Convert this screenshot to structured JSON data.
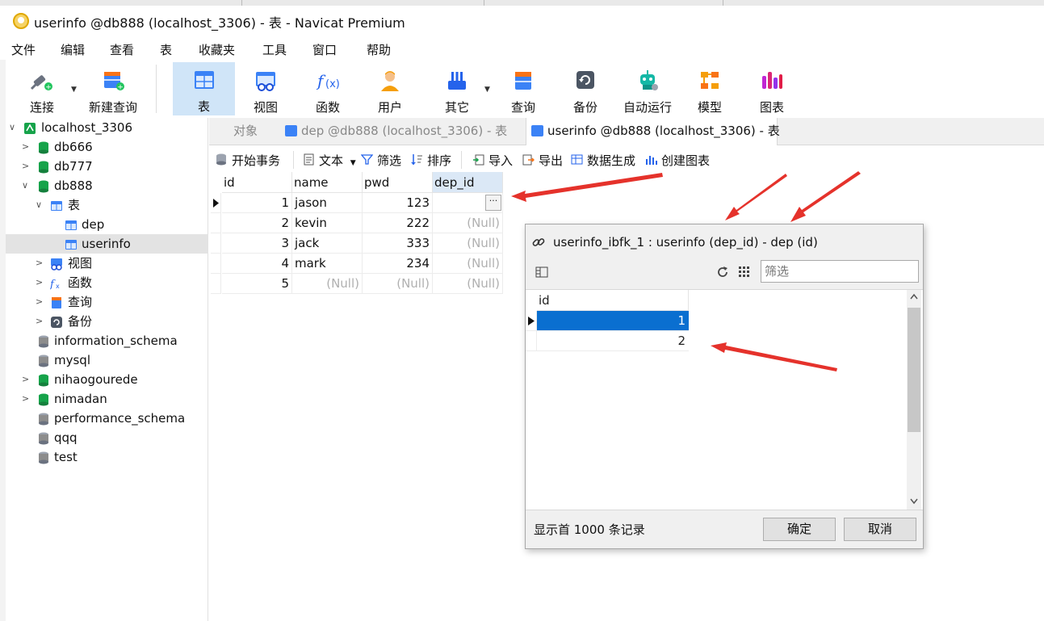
{
  "window": {
    "title": "userinfo @db888 (localhost_3306) - 表 - Navicat Premium"
  },
  "menubar": {
    "items": [
      "文件",
      "编辑",
      "查看",
      "表",
      "收藏夹",
      "工具",
      "窗口",
      "帮助"
    ]
  },
  "toolbar": {
    "buttons": [
      "连接",
      "新建查询",
      "表",
      "视图",
      "函数",
      "用户",
      "其它",
      "查询",
      "备份",
      "自动运行",
      "模型",
      "图表"
    ],
    "active": "表"
  },
  "tree": {
    "items": [
      {
        "label": "localhost_3306"
      },
      {
        "label": "db666"
      },
      {
        "label": "db777"
      },
      {
        "label": "db888"
      },
      {
        "label": "表"
      },
      {
        "label": "dep"
      },
      {
        "label": "userinfo"
      },
      {
        "label": "视图"
      },
      {
        "label": "函数"
      },
      {
        "label": "查询"
      },
      {
        "label": "备份"
      },
      {
        "label": "information_schema"
      },
      {
        "label": "mysql"
      },
      {
        "label": "nihaogourede"
      },
      {
        "label": "nimadan"
      },
      {
        "label": "performance_schema"
      },
      {
        "label": "qqq"
      },
      {
        "label": "test"
      }
    ],
    "selected": "userinfo"
  },
  "doctabs": {
    "tabs": [
      "对象",
      "dep @db888 (localhost_3306) - 表",
      "userinfo @db888 (localhost_3306) - 表"
    ],
    "active": "userinfo @db888 (localhost_3306) - 表"
  },
  "datatoolbar": {
    "buttons": [
      "开始事务",
      "文本",
      "筛选",
      "排序",
      "导入",
      "导出",
      "数据生成",
      "创建图表"
    ]
  },
  "grid": {
    "columns": [
      "id",
      "name",
      "pwd",
      "dep_id"
    ],
    "rows": [
      [
        "1",
        "jason",
        "123",
        ""
      ],
      [
        "2",
        "kevin",
        "222",
        "(Null)"
      ],
      [
        "3",
        "jack",
        "333",
        "(Null)"
      ],
      [
        "4",
        "mark",
        "234",
        "(Null)"
      ],
      [
        "5",
        "(Null)",
        "(Null)",
        "(Null)"
      ]
    ],
    "ellipsis": "···"
  },
  "popup": {
    "title": "userinfo_ibfk_1 : userinfo (dep_id) - dep (id)",
    "filter_placeholder": "筛选",
    "column": "id",
    "rows": [
      "1",
      "2"
    ],
    "selected_row": "1",
    "footer": "显示首 1000 条记录",
    "ok_label": "确定",
    "cancel_label": "取消"
  },
  "colors": {
    "accent": "#0a6fd0",
    "active_toolbar": "#d0e5f8",
    "annotation_arrow": "#e5322b"
  }
}
